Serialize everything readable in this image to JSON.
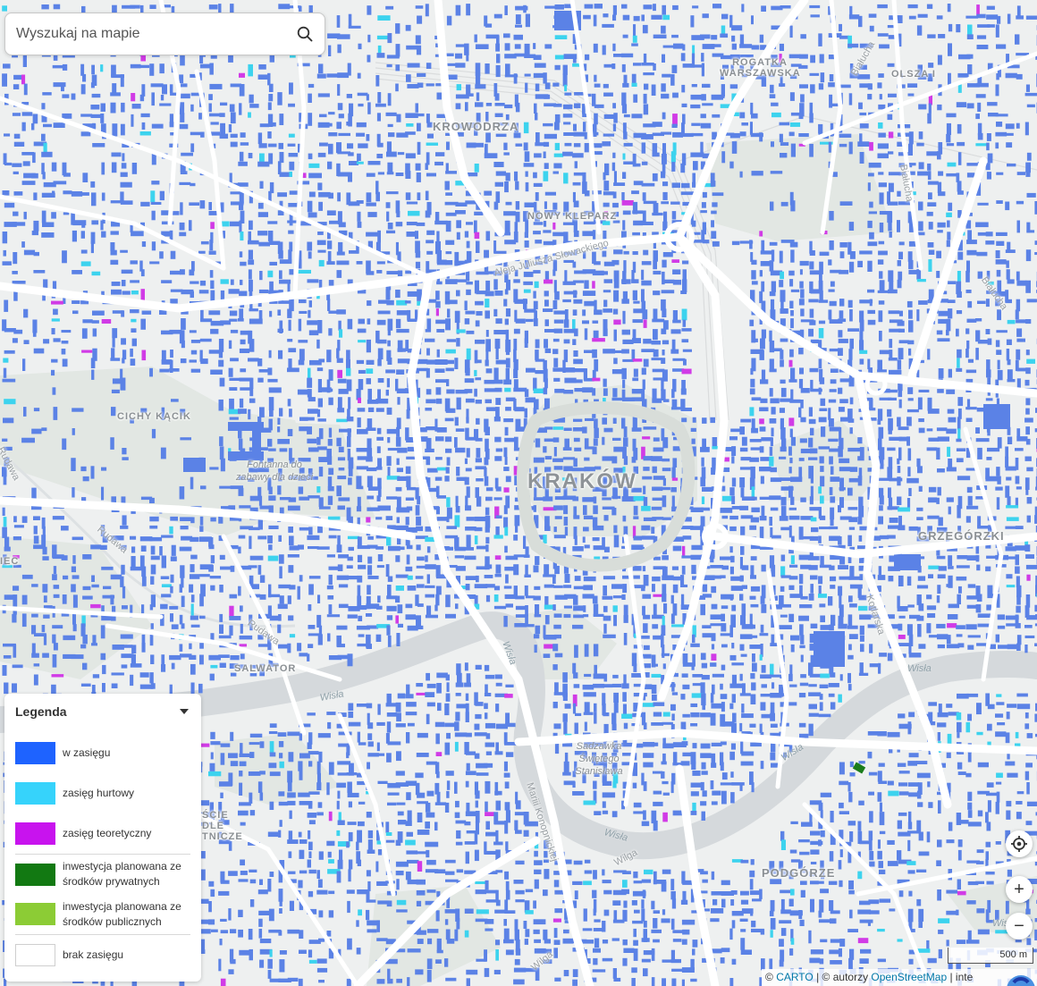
{
  "search": {
    "placeholder": "Wyszukaj na mapie"
  },
  "map": {
    "colors": {
      "background": "#eef0f0",
      "green_area": "#e1e6e2",
      "road": "#ffffff",
      "river": "#d6dadd",
      "building_in_range": "#5b82e6",
      "building_wholesale": "#3cd3ee",
      "building_theoretical": "#d13be6",
      "building_private_invest": "#1b7c1b"
    },
    "labels": {
      "city": "KRAKÓW",
      "districts": [
        "KROWODRZA",
        "NOWY KLEPARZ",
        "ROGATKA WARSZAWSKA",
        "OLSZA I",
        "CICHY KĄCIK",
        "GRZEGÓRZKI",
        "SALWATOR",
        "PODGÓRZE",
        "ŚCIE DLE TNICZE",
        "IEC"
      ],
      "streets": [
        "Aleja Juliusza Słowackiego",
        "Białucha",
        "Rudawa",
        "Rudawa",
        "Rudawa",
        "Mariii Konopnickiej",
        "Kotlarska",
        "Wilga",
        "Wilga",
        "Białucha",
        "Białucha"
      ],
      "rivers": [
        "Wisła",
        "Wisła",
        "Wisła",
        "Wisła",
        "Wisła",
        "Wisła"
      ],
      "pois": [
        "Fontanna do zabawy dla dzieci",
        "Sadzawka Świętego Stanisława"
      ]
    }
  },
  "legend": {
    "title": "Legenda",
    "items": [
      {
        "label": "w zasięgu",
        "color": "#1e63ff"
      },
      {
        "label": "zasięg hurtowy",
        "color": "#36d3fb"
      },
      {
        "label": "zasięg teoretyczny",
        "color": "#c813ee"
      },
      {
        "label": "inwestycja planowana ze środków prywatnych",
        "color": "#127912"
      },
      {
        "label": "inwestycja planowana ze środków publicznych",
        "color": "#8ccc35"
      },
      {
        "label": "brak zasięgu",
        "color": "#ffffff"
      }
    ]
  },
  "controls": {
    "locate_icon": "crosshair-icon",
    "zoom_in": "+",
    "zoom_out": "−"
  },
  "scale": {
    "label": "500 m"
  },
  "attribution": {
    "prefix": "© ",
    "carto": "CARTO",
    "mid": " | © autorzy ",
    "osm": "OpenStreetMap",
    "suffix": " | inte"
  }
}
